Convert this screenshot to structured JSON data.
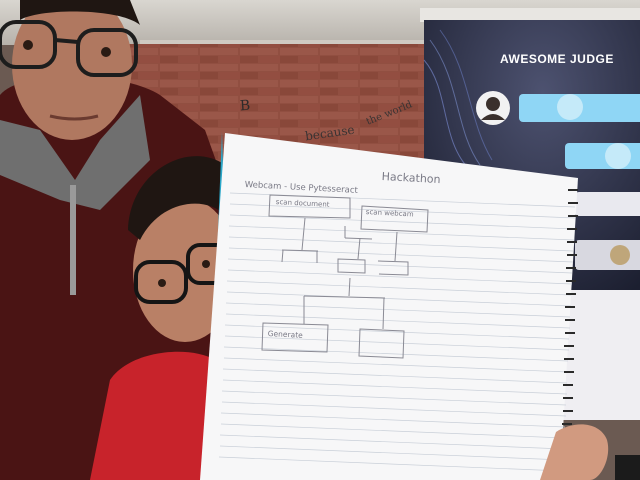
{
  "slide": {
    "title": "AWESOME JUDGE"
  },
  "wall": {
    "scribble_1": "B",
    "scribble_2": "because",
    "scribble_3": "the world"
  },
  "notebook": {
    "title": "Hackathon",
    "subtitle": "Webcam - Use Pytesseract",
    "box_1": "scan document",
    "box_2": "scan webcam",
    "box_3": "Generate"
  },
  "colors": {
    "notebook_cover": "#2aa7c9",
    "slide_bg": "#2b2f45",
    "slide_bar": "#8fd6f5",
    "sweater_maroon": "#4a1414",
    "shirt_red": "#c8232b",
    "brick_wall": "#a8594a"
  }
}
